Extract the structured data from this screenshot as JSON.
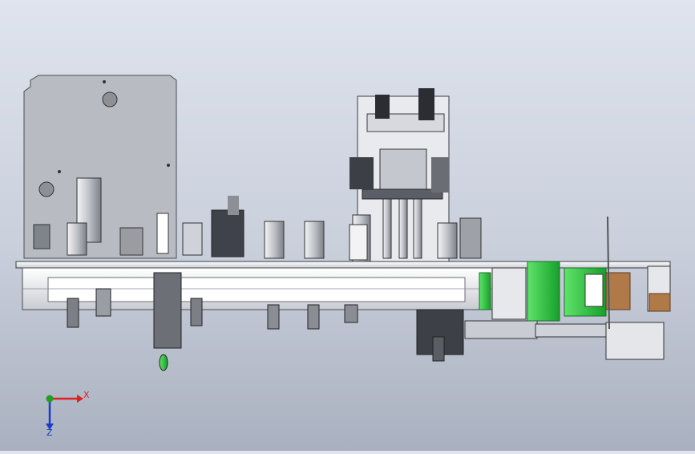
{
  "viewport": {
    "background_top": "#dfe4ee",
    "background_bottom": "#a9b0bf"
  },
  "triad": {
    "x_label": "X",
    "z_label": "Z",
    "x_color": "#e02020",
    "z_color": "#1a3cc8",
    "origin_color": "#20a020"
  },
  "colors": {
    "frame": "#e8e8ea",
    "panel": "#b9bbc2",
    "steel": "#cfd2d8",
    "dark": "#2b2d33",
    "green": "#27c43a",
    "wood": "#b07a48"
  }
}
